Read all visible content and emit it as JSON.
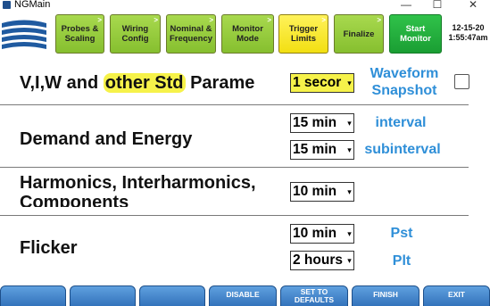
{
  "window": {
    "title": "NGMain",
    "minimize": "—",
    "maximize": "☐",
    "close": "✕"
  },
  "toolbar": {
    "steps": [
      {
        "label": "Probes & Scaling",
        "color": "green"
      },
      {
        "label": "Wiring Config",
        "color": "green"
      },
      {
        "label": "Nominal & Frequency",
        "color": "green"
      },
      {
        "label": "Monitor Mode",
        "color": "green"
      },
      {
        "label": "Trigger Limits",
        "color": "yellow"
      },
      {
        "label": "Finalize",
        "color": "green"
      },
      {
        "label": "Start Monitor",
        "color": "start"
      }
    ],
    "date": "12-15-20",
    "time": "1:55:47am"
  },
  "rows": {
    "vi": {
      "label_prefix": "V,I,W and ",
      "label_highlight": "other Std",
      "label_suffix": " Parame",
      "value": "1 secor",
      "right_label_1": "Waveform",
      "right_label_2": "Snapshot"
    },
    "demand": {
      "label": "Demand and Energy",
      "interval_value": "15 min",
      "interval_label": "interval",
      "subinterval_value": "15 min",
      "subinterval_label": "subinterval"
    },
    "harmonics": {
      "label_line1": "Harmonics, Interharmonics,",
      "label_line2": "Components",
      "value": "10 min"
    },
    "flicker": {
      "label": "Flicker",
      "pst_value": "10 min",
      "pst_label": "Pst",
      "plt_value": "2 hours",
      "plt_label": "Plt"
    }
  },
  "bottom_keys": [
    {
      "label": ""
    },
    {
      "label": ""
    },
    {
      "label": ""
    },
    {
      "label": "DISABLE"
    },
    {
      "label": "SET TO DEFAULTS"
    },
    {
      "label": "FINISH"
    },
    {
      "label": "EXIT"
    }
  ],
  "colors": {
    "step_green": "#a8d94e",
    "step_yellow": "#f2df12",
    "start_green": "#1a9e33",
    "accent_blue": "#2f8fd8",
    "key_blue": "#2f6fb8",
    "highlight": "#f6f24a"
  }
}
